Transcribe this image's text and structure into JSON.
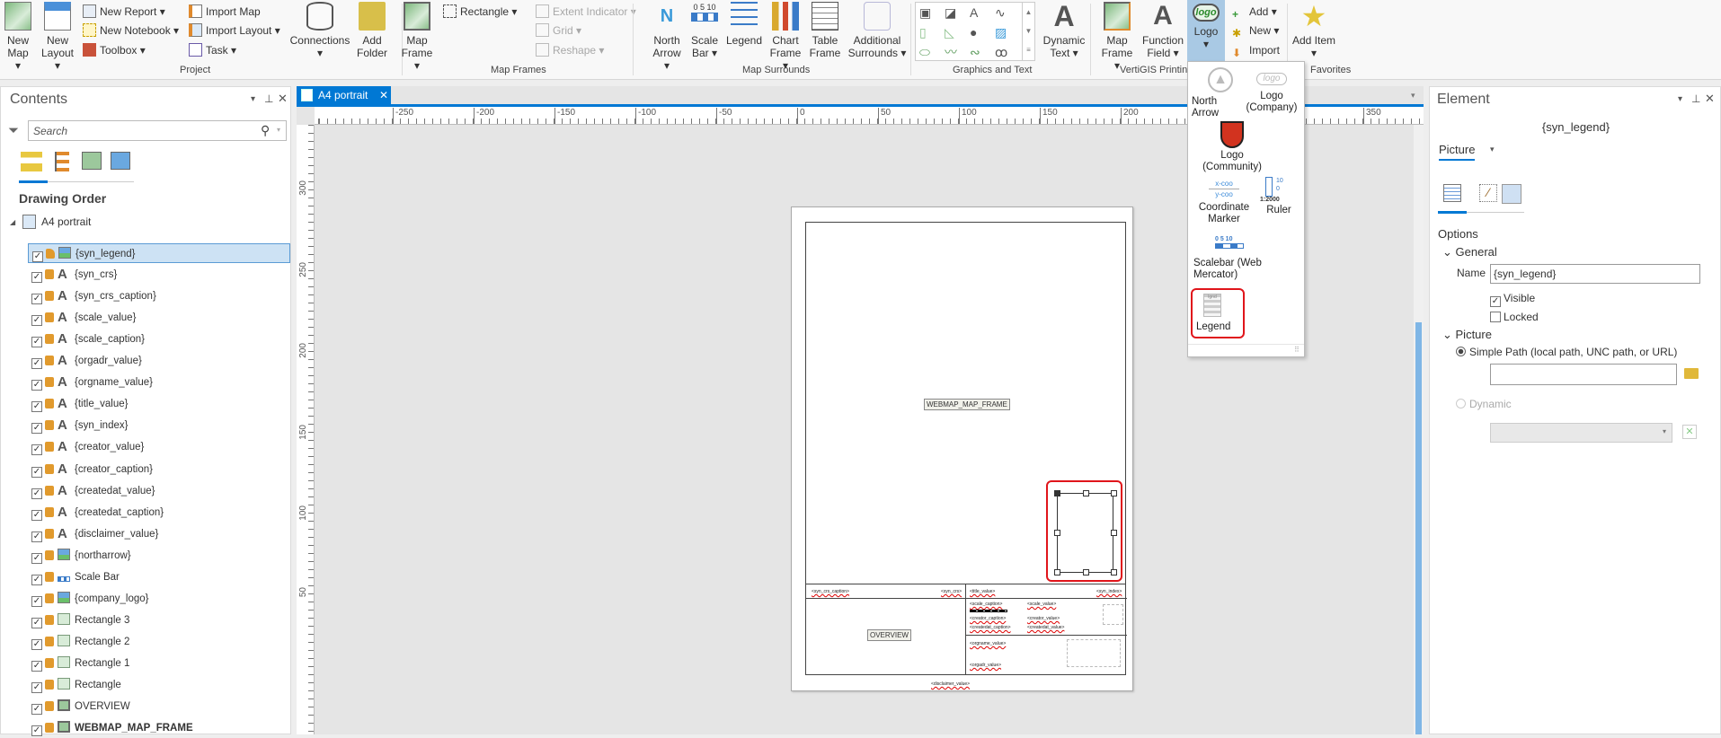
{
  "ribbon": {
    "project": {
      "new_map": "New Map",
      "new_layout": "New Layout",
      "new_report": "New Report",
      "new_notebook": "New Notebook",
      "toolbox": "Toolbox",
      "import_map": "Import Map",
      "import_layout": "Import Layout",
      "task": "Task",
      "connections": "Connections",
      "add_folder": "Add Folder",
      "label": "Project"
    },
    "map_frames": {
      "map_frame": "Map Frame",
      "rectangle": "Rectangle",
      "extent_indicator": "Extent Indicator",
      "grid": "Grid",
      "reshape": "Reshape",
      "label": "Map Frames"
    },
    "map_surrounds": {
      "north_arrow": "North Arrow",
      "scale_bar": "Scale Bar",
      "legend": "Legend",
      "chart_frame": "Chart Frame",
      "table_frame": "Table Frame",
      "additional_surrounds": "Additional Surrounds",
      "label": "Map Surrounds"
    },
    "graphics": {
      "dynamic_text": "Dynamic Text",
      "label": "Graphics and Text"
    },
    "vertigis": {
      "map_frame": "Map Frame",
      "function_field": "Function Field",
      "logo": "Logo",
      "label": "VertiGIS Printing"
    },
    "favorites": {
      "add": "Add",
      "new": "New",
      "import": "Import",
      "add_item": "Add Item",
      "label": "Favorites"
    }
  },
  "logo_menu": {
    "items": [
      "North Arrow",
      "Logo (Company)",
      "Logo (Community)",
      "Coordinate Marker",
      "Ruler",
      "Scalebar (Web Mercator)",
      "Legend"
    ],
    "ruler_top": "10",
    "ruler_bottom": "0",
    "ruler_scale": "1:2000",
    "scalebar_ticks": "0  5 10",
    "logo_text": "logo",
    "coord_x": "x-coo",
    "coord_y": "y-coo",
    "legend_text": "lgnd"
  },
  "contents": {
    "title": "Contents",
    "search_placeholder": "Search",
    "drawing_order": "Drawing Order",
    "root": "A4 portrait",
    "items": [
      {
        "name": "{syn_legend}",
        "icon": "picture",
        "locked": false,
        "selected": true
      },
      {
        "name": "{syn_crs}",
        "icon": "text",
        "locked": true
      },
      {
        "name": "{syn_crs_caption}",
        "icon": "text",
        "locked": true
      },
      {
        "name": "{scale_value}",
        "icon": "text",
        "locked": true
      },
      {
        "name": "{scale_caption}",
        "icon": "text",
        "locked": true
      },
      {
        "name": "{orgadr_value}",
        "icon": "text",
        "locked": true
      },
      {
        "name": "{orgname_value}",
        "icon": "text",
        "locked": true
      },
      {
        "name": "{title_value}",
        "icon": "text",
        "locked": true
      },
      {
        "name": "{syn_index}",
        "icon": "text",
        "locked": true
      },
      {
        "name": "{creator_value}",
        "icon": "text",
        "locked": true
      },
      {
        "name": "{creator_caption}",
        "icon": "text",
        "locked": true
      },
      {
        "name": "{createdat_value}",
        "icon": "text",
        "locked": true
      },
      {
        "name": "{createdat_caption}",
        "icon": "text",
        "locked": true
      },
      {
        "name": "{disclaimer_value}",
        "icon": "text",
        "locked": true
      },
      {
        "name": "{northarrow}",
        "icon": "picture",
        "locked": true
      },
      {
        "name": "Scale Bar",
        "icon": "scalebar",
        "locked": true
      },
      {
        "name": "{company_logo}",
        "icon": "picture",
        "locked": true
      },
      {
        "name": "Rectangle 3",
        "icon": "rect",
        "locked": true
      },
      {
        "name": "Rectangle 2",
        "icon": "rect",
        "locked": true
      },
      {
        "name": "Rectangle 1",
        "icon": "rect",
        "locked": true
      },
      {
        "name": "Rectangle",
        "icon": "rect",
        "locked": true
      },
      {
        "name": "OVERVIEW",
        "icon": "map",
        "locked": true
      },
      {
        "name": "WEBMAP_MAP_FRAME",
        "icon": "map",
        "locked": true,
        "bold": true
      }
    ]
  },
  "layout": {
    "tab": "A4 portrait",
    "close": "✕",
    "hruler": [
      "-250",
      "-200",
      "-150",
      "-100",
      "-50",
      "0",
      "50",
      "100",
      "150",
      "200",
      "250",
      "300",
      "350"
    ],
    "vruler": [
      "300",
      "250",
      "200",
      "150",
      "100",
      "50"
    ],
    "map_frame_label": "WEBMAP_MAP_FRAME",
    "overview_label": "OVERVIEW",
    "fields": {
      "syn_crs_caption": "<syn_crs_caption>",
      "syn_crs": "<syn_crs>",
      "title_value": "<title_value>",
      "syn_index": "<syn_index>",
      "scale_caption": "<scale_caption>",
      "scale_value": "<scale_value>",
      "creator_caption": "<creator_caption>",
      "creator_value": "<creator_value>",
      "createdat_caption": "<createdat_caption>",
      "createdat_value": "<createdat_value>",
      "orgname_value": "<orgname_value>",
      "orgadr_value": "<orgadr_value>",
      "disclaimer_value": "<disclaimer_value>"
    }
  },
  "element": {
    "title": "Element",
    "element_name": "{syn_legend}",
    "type_tab": "Picture",
    "options": "Options",
    "general": "General",
    "name_label": "Name",
    "name_value": "{syn_legend}",
    "visible": "Visible",
    "locked": "Locked",
    "picture_section": "Picture",
    "simple_path": "Simple Path (local path, UNC path, or URL)",
    "path_value": "",
    "dynamic": "Dynamic"
  },
  "colors": {
    "accent": "#0078d4",
    "highlight": "#e0151b",
    "selection": "#cde2f4"
  }
}
